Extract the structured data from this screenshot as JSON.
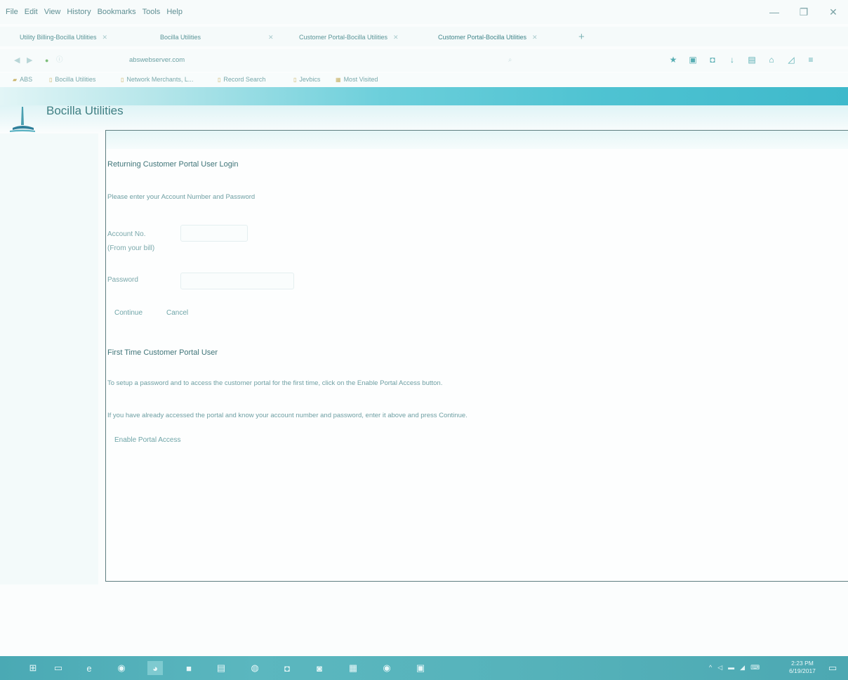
{
  "browser": {
    "menu": [
      "File",
      "Edit",
      "View",
      "History",
      "Bookmarks",
      "Tools",
      "Help"
    ],
    "window_controls": {
      "minimize": "—",
      "restore": "❐",
      "close": "✕"
    },
    "tabs": [
      {
        "label": "Utility Billing-Bocilla Utilities",
        "active": false
      },
      {
        "label": "Bocilla Utilities",
        "active": false
      },
      {
        "label": "Customer Portal-Bocilla Utilities",
        "active": false
      },
      {
        "label": "Customer Portal-Bocilla Utilities",
        "active": true
      }
    ],
    "new_tab": "+",
    "url": "abswebserver.com",
    "bookmarks": [
      "ABS",
      "Bocilla Utilities",
      "Network Merchants, L...",
      "Record Search",
      "Jevbics",
      "Most Visited"
    ]
  },
  "site": {
    "title": "Bocilla Utilities"
  },
  "login": {
    "returning_heading": "Returning Customer Portal User Login",
    "instructions": "Please enter your Account Number and Password",
    "account_label": "Account No.",
    "account_hint": "(From your bill)",
    "account_value": "",
    "password_label": "Password",
    "password_value": "",
    "continue_label": "Continue",
    "cancel_label": "Cancel"
  },
  "first_time": {
    "heading": "First Time Customer Portal User",
    "line1": "To setup a password and to access the customer portal for the first time, click on the Enable Portal Access button.",
    "line2": "If you have already accessed the portal and know your account number and password, enter it above and press Continue.",
    "enable_label": "Enable Portal Access"
  },
  "taskbar": {
    "time": "2:23 PM",
    "date": "6/19/2017"
  },
  "colors": {
    "accent": "#4fc3d2",
    "heading": "#3f7478",
    "text": "#6e9fa3",
    "taskbar": "#56b3bb"
  }
}
